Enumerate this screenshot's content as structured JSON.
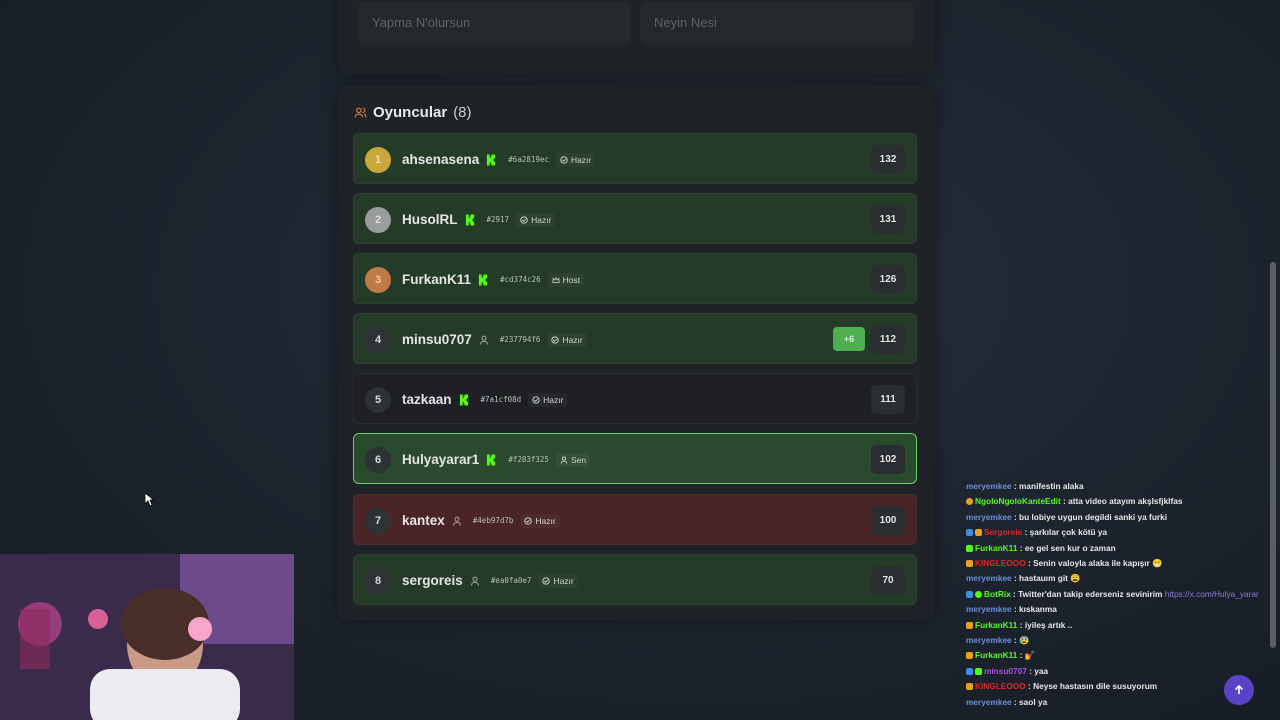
{
  "top_inputs": {
    "field1_placeholder": "Yapma N'olursun",
    "field2_placeholder": "Neyin Nesi"
  },
  "players": {
    "title": "Oyuncular",
    "count": "(8)",
    "rows": [
      {
        "rank": "1",
        "name": "ahsenasena",
        "tag": "#6a2819ec",
        "status": "Hazır",
        "score": "132",
        "plus": ""
      },
      {
        "rank": "2",
        "name": "HusolRL",
        "tag": "#2917",
        "status": "Hazır",
        "score": "131",
        "plus": ""
      },
      {
        "rank": "3",
        "name": "FurkanK11",
        "tag": "#cd374c26",
        "status": "Host",
        "score": "126",
        "plus": ""
      },
      {
        "rank": "4",
        "name": "minsu0707",
        "tag": "#237794f6",
        "status": "Hazır",
        "score": "112",
        "plus": "+6"
      },
      {
        "rank": "5",
        "name": "tazkaan",
        "tag": "#7a1cf08d",
        "status": "Hazır",
        "score": "111",
        "plus": ""
      },
      {
        "rank": "6",
        "name": "Hulyayarar1",
        "tag": "#f283f325",
        "status": "Sen",
        "score": "102",
        "plus": ""
      },
      {
        "rank": "7",
        "name": "kantex",
        "tag": "#4eb97d7b",
        "status": "Hazır",
        "score": "100",
        "plus": ""
      },
      {
        "rank": "8",
        "name": "sergoreis",
        "tag": "#ea0fa0e7",
        "status": "Hazır",
        "score": "70",
        "plus": ""
      }
    ]
  },
  "chat": [
    {
      "user": "meryemkee",
      "sep": " : ",
      "msg": "manifestin alaka"
    },
    {
      "user": "NgoloNgoloKanteEdit",
      "sep": " : ",
      "msg": "atta video atayım akşlsfjklfas"
    },
    {
      "user": "meryemkee",
      "sep": " : ",
      "msg": "bu lobiye uygun degildi sanki ya furki"
    },
    {
      "user": "Sergoreis",
      "sep": " : ",
      "msg": "şarkılar çok kötü ya"
    },
    {
      "user": "FurkanK11",
      "sep": " : ",
      "msg": "ee gel sen kur o zaman"
    },
    {
      "user": "KINGLEOOO",
      "sep": " : ",
      "msg": "Senin valoyla alaka ile kapışır 😁"
    },
    {
      "user": "meryemkee",
      "sep": " : ",
      "msg": "hastauım git 😩"
    },
    {
      "user": "BotRix",
      "sep": " : ",
      "msg": "Twitter'dan takip ederseniz sevinirim ",
      "link": "https://x.com/Hulya_yarar"
    },
    {
      "user": "meryemkee",
      "sep": " : ",
      "msg": "kıskanma"
    },
    {
      "user": "FurkanK11",
      "sep": " : ",
      "msg": "iyileş artık .."
    },
    {
      "user": "meryemkee",
      "sep": " : ",
      "msg": "😰"
    },
    {
      "user": "FurkanK11",
      "sep": " : ",
      "msg": "💅"
    },
    {
      "user": "minsu0707",
      "sep": " : ",
      "msg": "yaa"
    },
    {
      "user": "KINGLEOOO",
      "sep": " : ",
      "msg": "Neyse hastasın dile susuyorum"
    },
    {
      "user": "meryemkee",
      "sep": " : ",
      "msg": "saol ya"
    }
  ],
  "colors": {
    "accent": "#5a43c6",
    "row_green": "#243b27",
    "row_red": "#4a2426",
    "self_border": "#6ecb71"
  }
}
